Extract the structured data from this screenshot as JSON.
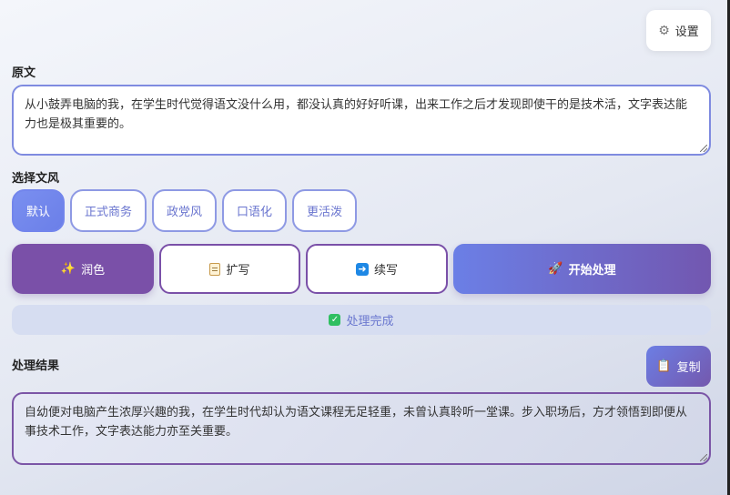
{
  "settings": {
    "label": "设置",
    "icon": "gear-icon"
  },
  "original": {
    "label": "原文",
    "text": "从小鼓弄电脑的我，在学生时代觉得语文没什么用，都没认真的好好听课，出来工作之后才发现即使干的是技术活，文字表达能力也是极其重要的。"
  },
  "styles": {
    "label": "选择文风",
    "options": [
      {
        "label": "默认",
        "active": true
      },
      {
        "label": "正式商务",
        "active": false
      },
      {
        "label": "政党风",
        "active": false
      },
      {
        "label": "口语化",
        "active": false
      },
      {
        "label": "更活泼",
        "active": false
      }
    ]
  },
  "actions": {
    "polish": {
      "label": "润色",
      "icon": "sparkles-icon"
    },
    "expand": {
      "label": "扩写",
      "icon": "memo-icon"
    },
    "continue": {
      "label": "续写",
      "icon": "right-arrow-icon"
    },
    "start": {
      "label": "开始处理",
      "icon": "rocket-icon"
    }
  },
  "status": {
    "text": "处理完成",
    "icon": "check-icon",
    "color": "#2fbf61"
  },
  "result": {
    "label": "处理结果",
    "copy_label": "复制",
    "copy_icon": "clipboard-icon",
    "text": "自幼便对电脑产生浓厚兴趣的我，在学生时代却认为语文课程无足轻重，未曾认真聆听一堂课。步入职场后，方才领悟到即便从事技术工作，文字表达能力亦至关重要。"
  },
  "colors": {
    "accent": "#6b7fe8",
    "purple": "#7a50a8"
  }
}
